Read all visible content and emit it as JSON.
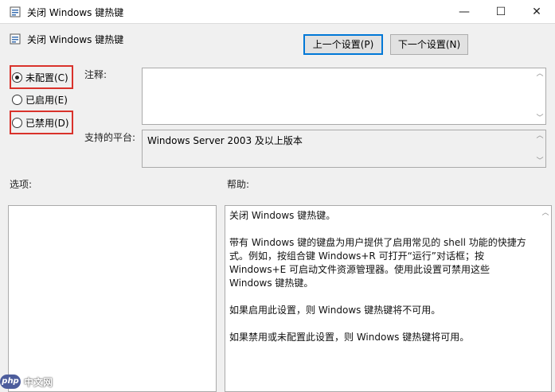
{
  "window": {
    "title": "关闭 Windows 键热键",
    "minimize_glyph": "—",
    "maximize_glyph": "☐",
    "close_glyph": "✕"
  },
  "header": {
    "title": "关闭 Windows 键热键"
  },
  "nav": {
    "prev_label": "上一个设置(P)",
    "next_label": "下一个设置(N)"
  },
  "state": {
    "options": [
      {
        "label": "未配置(C)",
        "checked": true
      },
      {
        "label": "已启用(E)",
        "checked": false
      },
      {
        "label": "已禁用(D)",
        "checked": false
      }
    ]
  },
  "comment": {
    "label": "注释:",
    "value": ""
  },
  "platform": {
    "label": "支持的平台:",
    "value": "Windows Server 2003 及以上版本"
  },
  "options_section": {
    "label": "选项:"
  },
  "help_section": {
    "label": "帮助:",
    "paragraphs": [
      "关闭 Windows 键热键。",
      "带有 Windows 键的键盘为用户提供了启用常见的 shell 功能的快捷方式。例如，按组合键 Windows+R 可打开“运行”对话框；按 Windows+E 可启动文件资源管理器。使用此设置可禁用这些 Windows 键热键。",
      "如果启用此设置，则 Windows 键热键将不可用。",
      "如果禁用或未配置此设置，则 Windows 键热键将可用。"
    ]
  },
  "watermark": {
    "logo": "php",
    "text": "中文网"
  },
  "colors": {
    "highlight_border": "#d9322b",
    "focus_border": "#0078d7"
  }
}
